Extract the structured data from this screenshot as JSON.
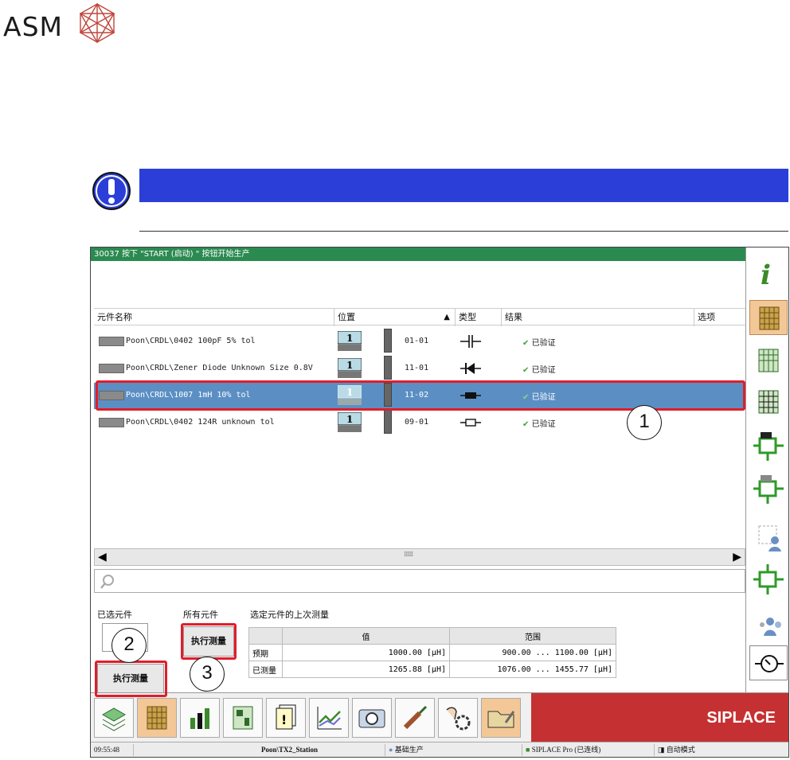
{
  "logo": {
    "text": "ASM"
  },
  "screen": {
    "status_message": "30037 按下 \"START (启动) \" 按钮开始生产",
    "columns": [
      "元件名称",
      "位置",
      "类型",
      "结果",
      "选项"
    ],
    "rows": [
      {
        "name": "Poon\\CRDL\\0402 100pF 5% tol",
        "feeder": "1",
        "position": "01-01",
        "type": "capacitor",
        "result": "已验证"
      },
      {
        "name": "Poon\\CRDL\\Zener Diode Unknown Size 0.8V",
        "feeder": "1",
        "position": "11-01",
        "type": "diode",
        "result": "已验证"
      },
      {
        "name": "Poon\\CRDL\\1007 1mH 10% tol",
        "feeder": "1",
        "position": "11-02",
        "type": "inductor",
        "result": "已验证",
        "selected": true
      },
      {
        "name": "Poon\\CRDL\\0402 124R unknown tol",
        "feeder": "1",
        "position": "09-01",
        "type": "resistor",
        "result": "已验证"
      }
    ],
    "selected_label": "已选元件",
    "all_label": "所有元件",
    "last_measure_label": "选定元件的上次测量",
    "exec_button": "执行测量",
    "table": {
      "headers": [
        "值",
        "范围"
      ],
      "rows": [
        {
          "label": "预期",
          "value": "1000.00 [μH]",
          "range": "900.00 ... 1100.00 [μH]"
        },
        {
          "label": "已测量",
          "value": "1265.88 [μH]",
          "range": "1076.00 ... 1455.77 [μH]"
        }
      ]
    },
    "brand": "SIPLACE",
    "statusbar": {
      "time": "09:55:48",
      "station": "Poon\\TX2_Station",
      "user": "基础生产",
      "connection": "SIPLACE Pro (已连线)",
      "mode": "自动模式"
    }
  },
  "callouts": [
    "1",
    "2",
    "3"
  ],
  "colors": {
    "status_green": "#2b8a50",
    "selection_blue": "#5b8fc4",
    "highlight_red": "#e11d2a",
    "info_blue": "#2b3fd8",
    "brand_red": "#c53132"
  }
}
